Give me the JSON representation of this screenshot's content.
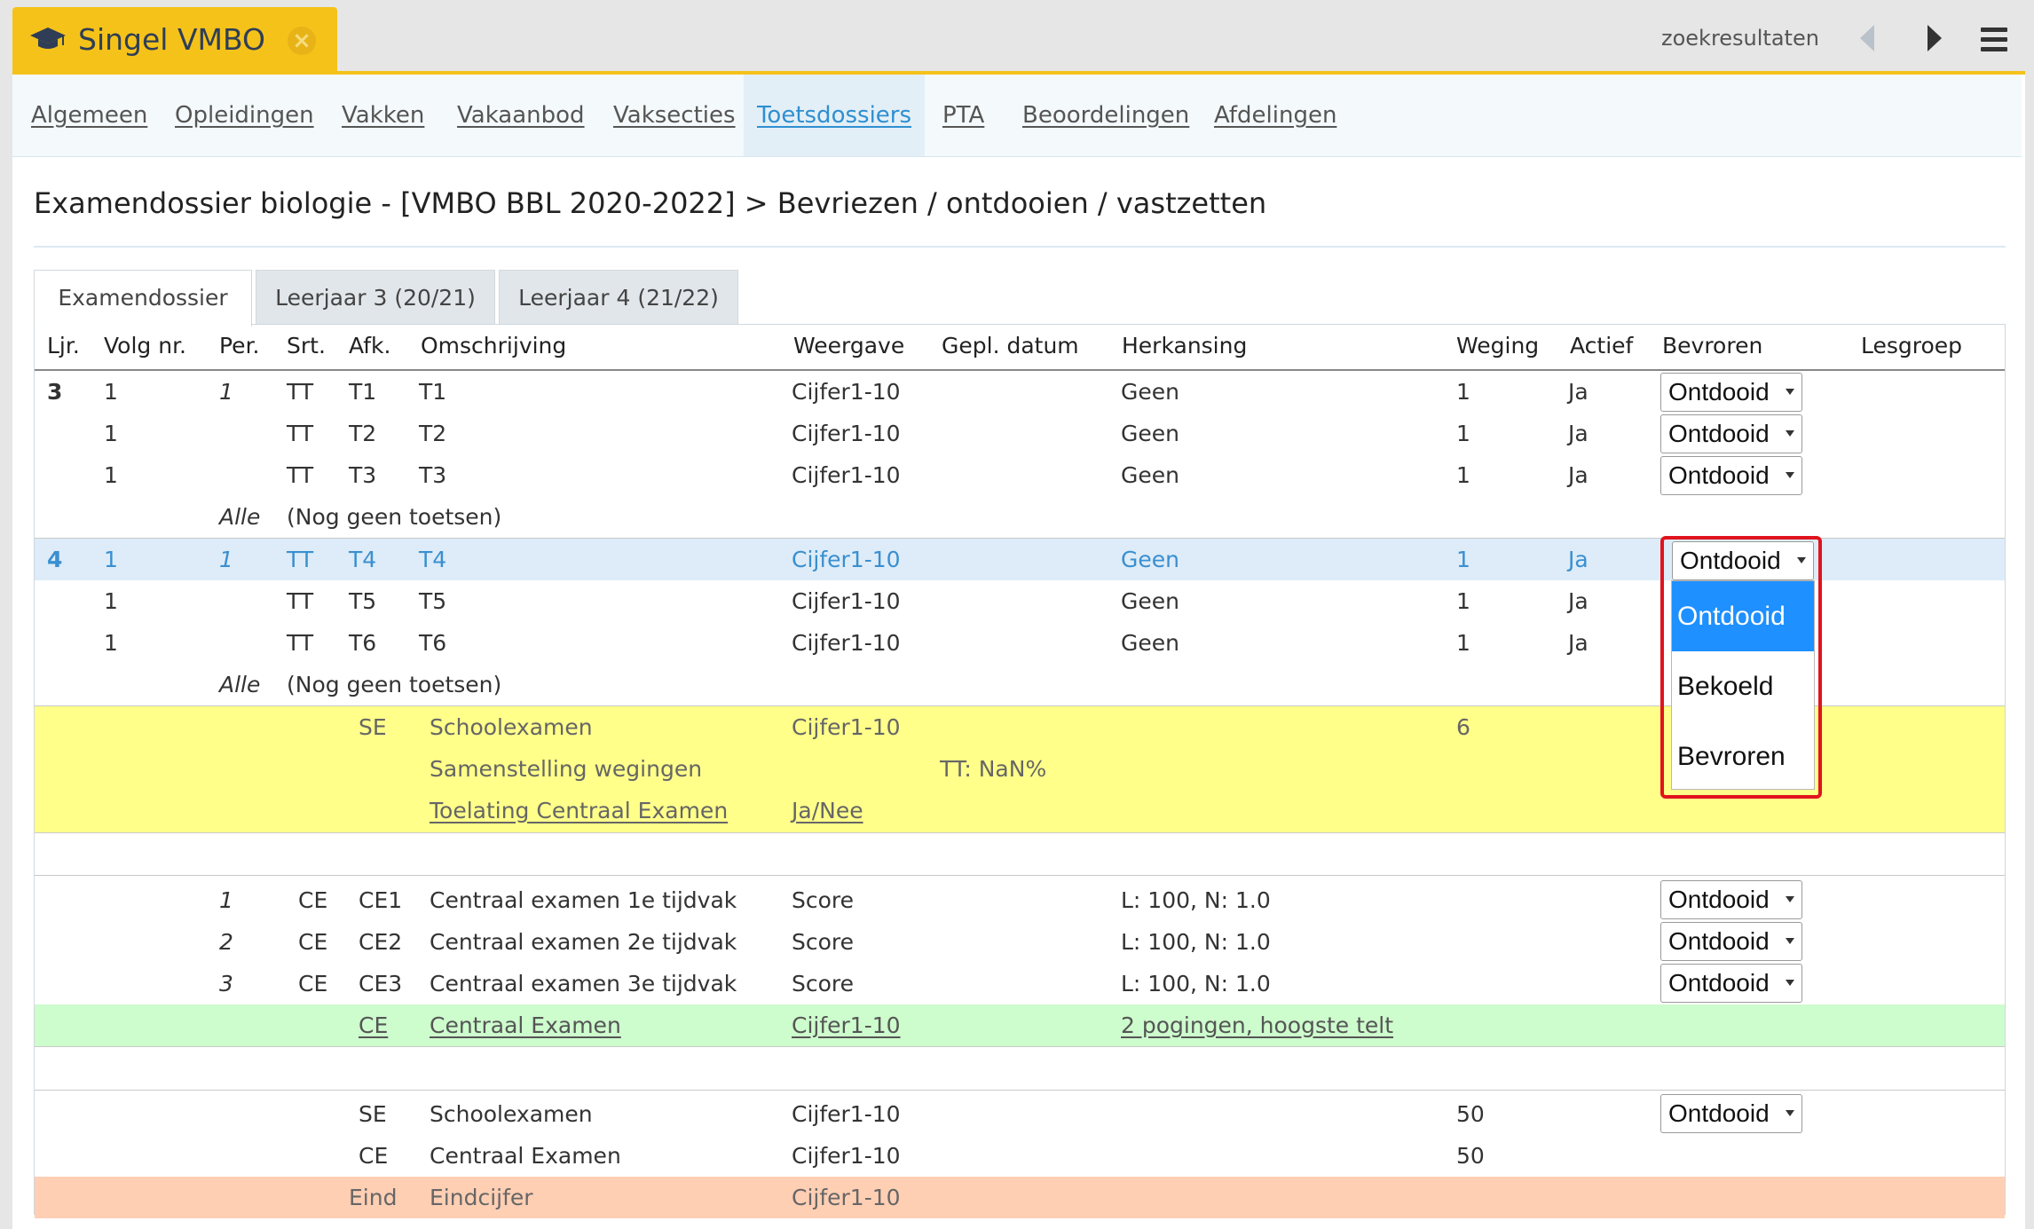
{
  "app": {
    "title": "Singel VMBO"
  },
  "topnav": {
    "search_results": "zoekresultaten"
  },
  "mainnav": [
    {
      "label": "Algemeen"
    },
    {
      "label": "Opleidingen"
    },
    {
      "label": "Vakken"
    },
    {
      "label": "Vakaanbod"
    },
    {
      "label": "Vaksecties"
    },
    {
      "label": "Toetsdossiers"
    },
    {
      "label": "PTA"
    },
    {
      "label": "Beoordelingen"
    },
    {
      "label": "Afdelingen"
    }
  ],
  "page": {
    "heading": "Examendossier biologie - [VMBO BBL 2020-2022] > Bevriezen / ontdooien / vastzetten"
  },
  "subtabs": [
    {
      "label": "Examendossier"
    },
    {
      "label": "Leerjaar 3 (20/21)"
    },
    {
      "label": "Leerjaar 4 (21/22)"
    }
  ],
  "columns": {
    "ljr": "Ljr.",
    "volg": "Volg nr.",
    "per": "Per.",
    "srt": "Srt.",
    "afk": "Afk.",
    "oms": "Omschrijving",
    "weer": "Weergave",
    "gepl": "Gepl. datum",
    "herk": "Herkansing",
    "weg": "Weging",
    "act": "Actief",
    "bev": "Bevroren",
    "les": "Lesgroep"
  },
  "rows": {
    "r1": {
      "ljr": "3",
      "volg": "1",
      "per": "1",
      "srt": "TT",
      "afk": "T1",
      "oms": "T1",
      "weer": "Cijfer1-10",
      "herk": "Geen",
      "weg": "1",
      "act": "Ja",
      "bev": "Ontdooid"
    },
    "r2": {
      "volg": "1",
      "srt": "TT",
      "afk": "T2",
      "oms": "T2",
      "weer": "Cijfer1-10",
      "herk": "Geen",
      "weg": "1",
      "act": "Ja",
      "bev": "Ontdooid"
    },
    "r3": {
      "volg": "1",
      "srt": "TT",
      "afk": "T3",
      "oms": "T3",
      "weer": "Cijfer1-10",
      "herk": "Geen",
      "weg": "1",
      "act": "Ja",
      "bev": "Ontdooid"
    },
    "r4": {
      "per": "Alle",
      "srt": "(Nog geen toetsen)"
    },
    "r5": {
      "ljr": "4",
      "volg": "1",
      "per": "1",
      "srt": "TT",
      "afk": "T4",
      "oms": "T4",
      "weer": "Cijfer1-10",
      "herk": "Geen",
      "weg": "1",
      "act": "Ja",
      "bev": "Ontdooid"
    },
    "r6": {
      "volg": "1",
      "srt": "TT",
      "afk": "T5",
      "oms": "T5",
      "weer": "Cijfer1-10",
      "herk": "Geen",
      "weg": "1",
      "act": "Ja"
    },
    "r7": {
      "volg": "1",
      "srt": "TT",
      "afk": "T6",
      "oms": "T6",
      "weer": "Cijfer1-10",
      "herk": "Geen",
      "weg": "1",
      "act": "Ja"
    },
    "r8": {
      "per": "Alle",
      "srt": "(Nog geen toetsen)"
    },
    "y1": {
      "afk": "SE",
      "oms": "Schoolexamen",
      "weer": "Cijfer1-10",
      "weg": "6"
    },
    "y2": {
      "oms": "Samenstelling wegingen",
      "gepl": "TT: NaN%"
    },
    "y3": {
      "oms": "Toelating Centraal Examen",
      "weer": "Ja/Nee"
    },
    "c1": {
      "per": "1",
      "srt": "CE",
      "afk": "CE1",
      "oms": "Centraal examen 1e tijdvak",
      "weer": "Score",
      "herk": "L: 100, N: 1.0",
      "bev": "Ontdooid"
    },
    "c2": {
      "per": "2",
      "srt": "CE",
      "afk": "CE2",
      "oms": "Centraal examen 2e tijdvak",
      "weer": "Score",
      "herk": "L: 100, N: 1.0",
      "bev": "Ontdooid"
    },
    "c3": {
      "per": "3",
      "srt": "CE",
      "afk": "CE3",
      "oms": "Centraal examen 3e tijdvak",
      "weer": "Score",
      "herk": "L: 100, N: 1.0",
      "bev": "Ontdooid"
    },
    "g1": {
      "afk": "CE",
      "oms": "Centraal Examen",
      "weer": "Cijfer1-10",
      "herk": "2 pogingen, hoogste telt"
    },
    "s1": {
      "afk": "SE",
      "oms": "Schoolexamen",
      "weer": "Cijfer1-10",
      "weg": "50",
      "bev": "Ontdooid"
    },
    "s2": {
      "afk": "CE",
      "oms": "Centraal Examen",
      "weer": "Cijfer1-10",
      "weg": "50"
    },
    "e1": {
      "afk": "Eind",
      "oms": "Eindcijfer",
      "weer": "Cijfer1-10"
    }
  },
  "dropdown": {
    "options": [
      "Ontdooid",
      "Bekoeld",
      "Bevroren"
    ],
    "selected": "Ontdooid"
  },
  "colors": {
    "accent": "#f5c21a",
    "link": "#2f8fd0",
    "highlight": "#1e90ff",
    "frame": "#e0141e"
  }
}
